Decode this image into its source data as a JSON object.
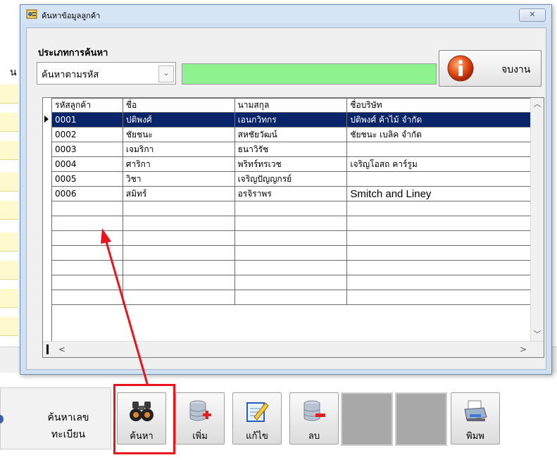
{
  "background": {
    "partial_char": "น"
  },
  "dialog": {
    "title": "ค้นหาข้อมูลลูกค้า",
    "close_label": "✕",
    "search_type_label": "ประเภทการค้นหา",
    "search_type_selected": "ค้นหาตามรหัส",
    "search_value": "",
    "end_button_label": "จบงาน"
  },
  "grid": {
    "columns": [
      "รหัสลูกค้า",
      "ชื่อ",
      "นามสกุล",
      "ชื่อบริษัท"
    ],
    "rows": [
      [
        "0001",
        "ปติพงศ์",
        "เอนกวิทกร",
        "ปติพงศ์  ค้าไม้ จำกัด"
      ],
      [
        "0002",
        "ชัยชนะ",
        "สหชัยวัฒน์",
        "ชัยชนะ เบลิค จำกัด"
      ],
      [
        "0003",
        "เจมริกา",
        "ธนาวิรัช",
        ""
      ],
      [
        "0004",
        "ศาริกา",
        "พริทร์ทรเวช",
        "เจริญโอสถ คาร์รูม"
      ],
      [
        "0005",
        "วิชา",
        "เจริญปัญญกรย์",
        ""
      ],
      [
        "0006",
        "สมิทร์",
        "อรจิราพร",
        "Smitch and Liney"
      ]
    ],
    "selected_row": 0
  },
  "left_button": {
    "line1": "ค้นหาเลข",
    "line2": "ทะเบียน"
  },
  "toolbar": {
    "search_label": "ค้นหา",
    "add_label": "เพิ่ม",
    "edit_label": "แก้ไข",
    "delete_label": "ลบ",
    "print_label": "พิมพ"
  },
  "colors": {
    "selection": "#0a246a",
    "search_input": "#8ef28e",
    "highlight": "#e8141e"
  }
}
